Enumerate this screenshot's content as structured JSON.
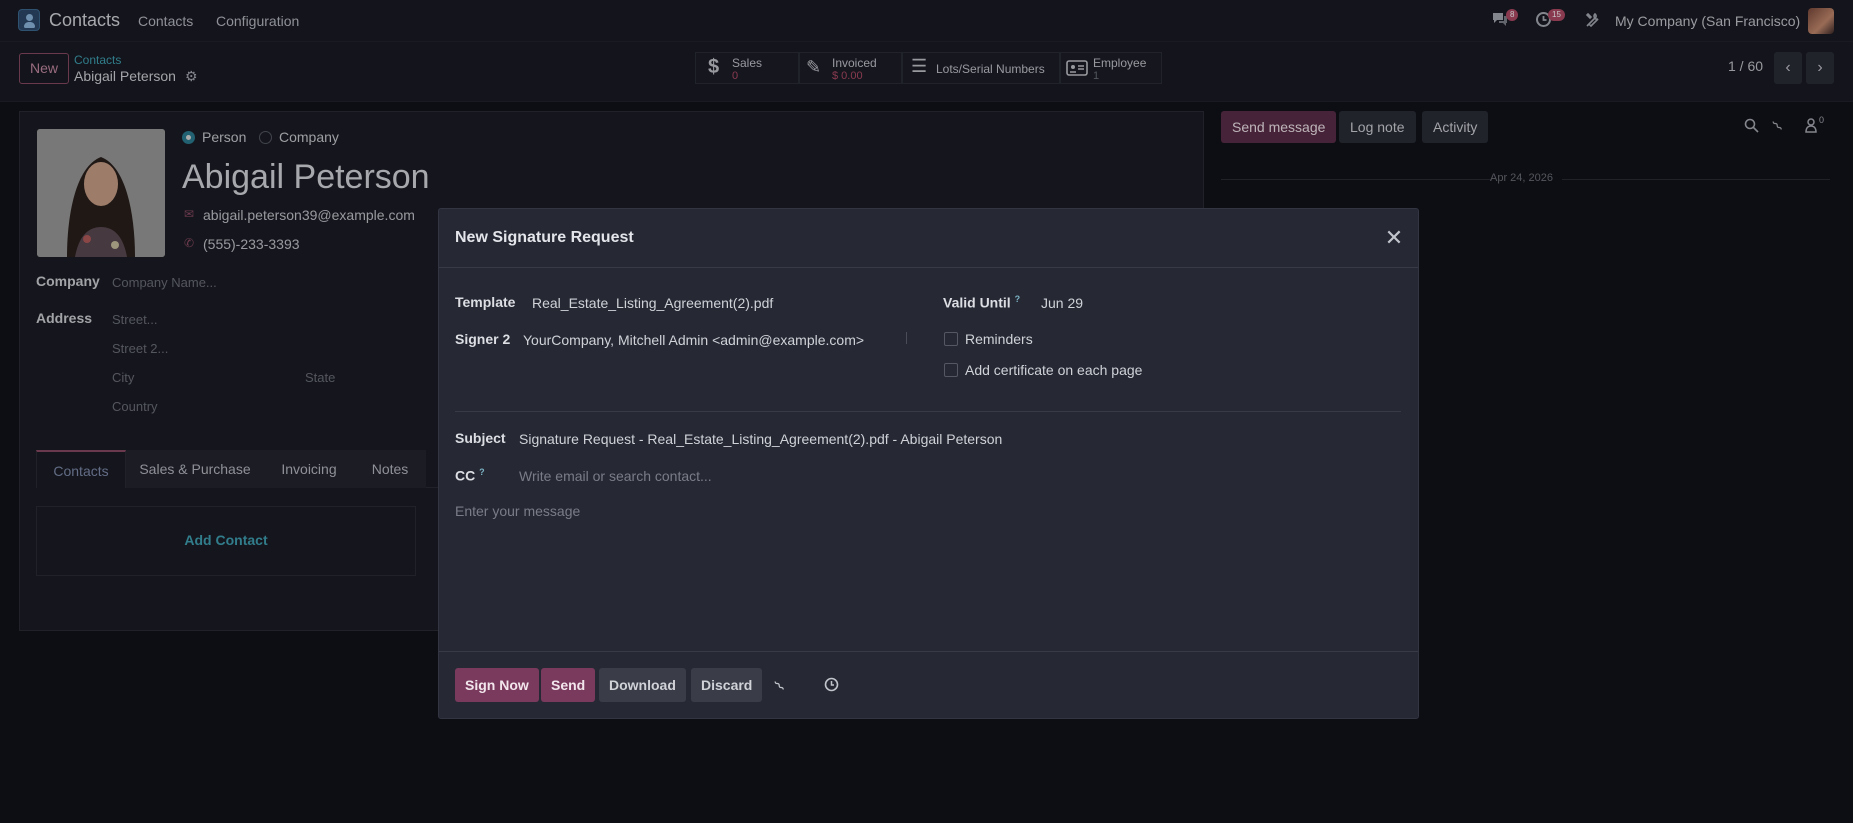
{
  "topbar": {
    "app_title": "Contacts",
    "menu": [
      "Contacts",
      "Configuration"
    ],
    "messages_badge": "8",
    "activities_badge": "15",
    "company": "My Company (San Francisco)"
  },
  "control_panel": {
    "new_label": "New",
    "breadcrumb_parent": "Contacts",
    "breadcrumb_current": "Abigail Peterson",
    "stats": {
      "sales_label": "Sales",
      "sales_value": "0",
      "invoiced_label": "Invoiced",
      "invoiced_value": "$ 0.00",
      "lots_label": "Lots/Serial Numbers",
      "employee_label": "Employee",
      "employee_value": "1"
    },
    "pager": "1 / 60"
  },
  "form": {
    "type_person": "Person",
    "type_company": "Company",
    "name": "Abigail Peterson",
    "email": "abigail.peterson39@example.com",
    "phone": "(555)-233-3393",
    "company_label": "Company",
    "company_placeholder": "Company Name...",
    "address_label": "Address",
    "street_placeholder": "Street...",
    "street2_placeholder": "Street 2...",
    "city_placeholder": "City",
    "state_placeholder": "State",
    "country_placeholder": "Country",
    "tabs": [
      "Contacts",
      "Sales & Purchase",
      "Invoicing",
      "Notes"
    ],
    "add_contact": "Add Contact"
  },
  "chatter": {
    "send_message": "Send message",
    "log_note": "Log note",
    "activity": "Activity",
    "followers_count": "0",
    "date": "Apr 24, 2026"
  },
  "modal": {
    "title": "New Signature Request",
    "template_label": "Template",
    "template_value": "Real_Estate_Listing_Agreement(2).pdf",
    "signer_label": "Signer 2",
    "signer_value": "YourCompany, Mitchell Admin <admin@example.com>",
    "valid_until_label": "Valid Until",
    "valid_until_value": "Jun 29",
    "reminders_label": "Reminders",
    "certificate_label": "Add certificate on each page",
    "subject_label": "Subject",
    "subject_value": "Signature Request - Real_Estate_Listing_Agreement(2).pdf - Abigail Peterson",
    "cc_label": "CC",
    "cc_placeholder": "Write email or search contact...",
    "message_placeholder": "Enter your message",
    "help_mark": "?",
    "buttons": {
      "sign_now": "Sign Now",
      "send": "Send",
      "download": "Download",
      "discard": "Discard"
    }
  },
  "colors": {
    "primary": "#7a3a5e",
    "link": "#3fa0b3",
    "background": "#111219"
  }
}
